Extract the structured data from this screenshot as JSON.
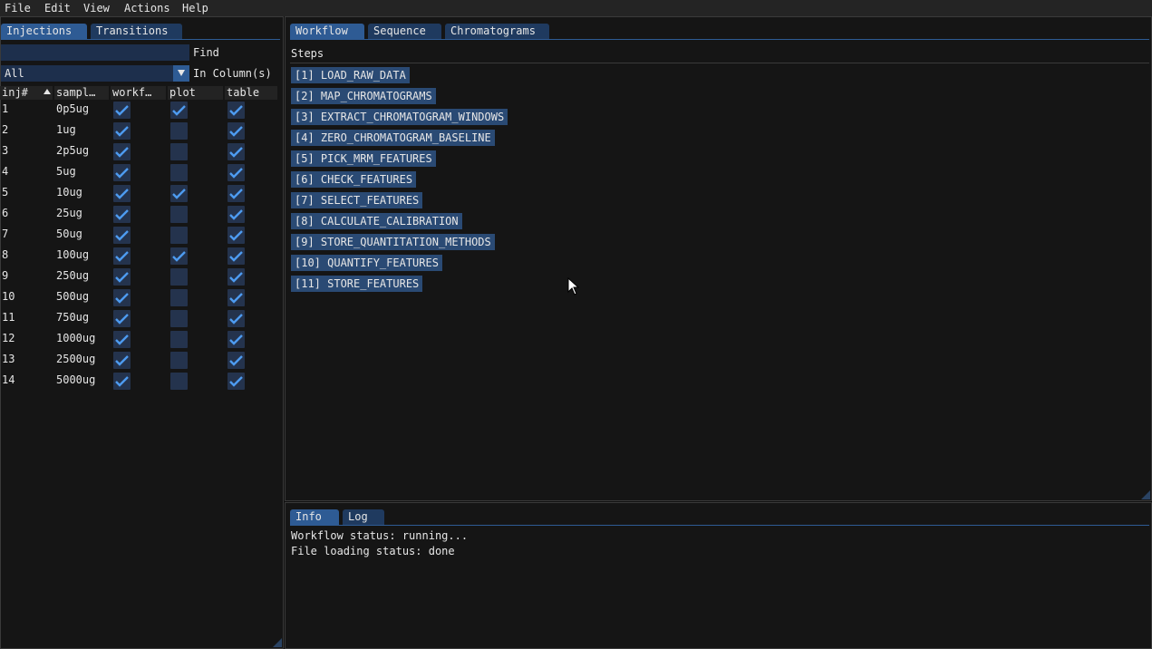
{
  "menu": [
    "File",
    "Edit",
    "View",
    "Actions",
    "Help"
  ],
  "left_tabs": [
    "Injections",
    "Transitions"
  ],
  "filter": {
    "find_value": "",
    "find_label": "Find",
    "column_value": "All",
    "column_label": "In Column(s)"
  },
  "table": {
    "headers": [
      "inj#",
      "sampl…",
      "workf…",
      "plot",
      "table"
    ],
    "rows": [
      {
        "inj": "1",
        "sample": "0p5ug",
        "workflow": true,
        "plot": true,
        "table": true
      },
      {
        "inj": "2",
        "sample": "1ug",
        "workflow": true,
        "plot": false,
        "table": true
      },
      {
        "inj": "3",
        "sample": "2p5ug",
        "workflow": true,
        "plot": false,
        "table": true
      },
      {
        "inj": "4",
        "sample": "5ug",
        "workflow": true,
        "plot": false,
        "table": true
      },
      {
        "inj": "5",
        "sample": "10ug",
        "workflow": true,
        "plot": true,
        "table": true
      },
      {
        "inj": "6",
        "sample": "25ug",
        "workflow": true,
        "plot": false,
        "table": true
      },
      {
        "inj": "7",
        "sample": "50ug",
        "workflow": true,
        "plot": false,
        "table": true
      },
      {
        "inj": "8",
        "sample": "100ug",
        "workflow": true,
        "plot": true,
        "table": true
      },
      {
        "inj": "9",
        "sample": "250ug",
        "workflow": true,
        "plot": false,
        "table": true
      },
      {
        "inj": "10",
        "sample": "500ug",
        "workflow": true,
        "plot": false,
        "table": true
      },
      {
        "inj": "11",
        "sample": "750ug",
        "workflow": true,
        "plot": false,
        "table": true
      },
      {
        "inj": "12",
        "sample": "1000ug",
        "workflow": true,
        "plot": false,
        "table": true
      },
      {
        "inj": "13",
        "sample": "2500ug",
        "workflow": true,
        "plot": false,
        "table": true
      },
      {
        "inj": "14",
        "sample": "5000ug",
        "workflow": true,
        "plot": false,
        "table": true
      }
    ]
  },
  "main_tabs": [
    "Workflow",
    "Sequence",
    "Chromatograms"
  ],
  "steps_label": "Steps",
  "steps": [
    "[1] LOAD_RAW_DATA",
    "[2] MAP_CHROMATOGRAMS",
    "[3] EXTRACT_CHROMATOGRAM_WINDOWS",
    "[4] ZERO_CHROMATOGRAM_BASELINE",
    "[5] PICK_MRM_FEATURES",
    "[6] CHECK_FEATURES",
    "[7] SELECT_FEATURES",
    "[8] CALCULATE_CALIBRATION",
    "[9] STORE_QUANTITATION_METHODS",
    "[10] QUANTIFY_FEATURES",
    "[11] STORE_FEATURES"
  ],
  "bottom_tabs": [
    "Info",
    "Log"
  ],
  "info": {
    "workflow_status": "Workflow status: running...",
    "file_status": "File loading status: done"
  },
  "colors": {
    "accent": "#2e5b94",
    "checkmark": "#4d9bf0",
    "checkbox_bg": "#24334d"
  }
}
